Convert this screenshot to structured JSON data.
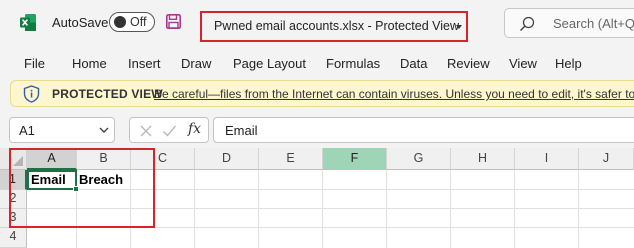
{
  "titlebar": {
    "autosave_label": "AutoSave",
    "autosave_state": "Off",
    "document_title": "Pwned email accounts.xlsx  -  Protected View",
    "search_placeholder": "Search (Alt+Q)"
  },
  "menu": [
    "File",
    "Home",
    "Insert",
    "Draw",
    "Page Layout",
    "Formulas",
    "Data",
    "Review",
    "View",
    "Help"
  ],
  "protected_view": {
    "title": "PROTECTED VIEW",
    "message": "Be careful—files from the Internet can contain viruses. Unless you need to edit, it's safer to stay in Protected View."
  },
  "formula_bar": {
    "name_box": "A1",
    "fx_label": "fx",
    "value": "Email"
  },
  "grid": {
    "columns": [
      "A",
      "B",
      "C",
      "D",
      "E",
      "F",
      "G",
      "H",
      "I",
      "J"
    ],
    "rows": [
      "1",
      "2",
      "3",
      "4"
    ],
    "cells": {
      "A1": "Email",
      "B1": "Breach"
    }
  },
  "colors": {
    "accent_green": "#1e7145",
    "highlight_red": "#d7232c",
    "protected_bar": "#fdf6cf",
    "excel_logo": "#107c41",
    "save_icon": "#a83b8e"
  },
  "icons": {
    "app": "excel-logo-icon",
    "save": "save-icon",
    "search": "search-icon",
    "shield": "shield-icon",
    "namebox_dropdown": "chevron-down-icon",
    "cancel": "close-icon",
    "enter": "check-icon"
  }
}
